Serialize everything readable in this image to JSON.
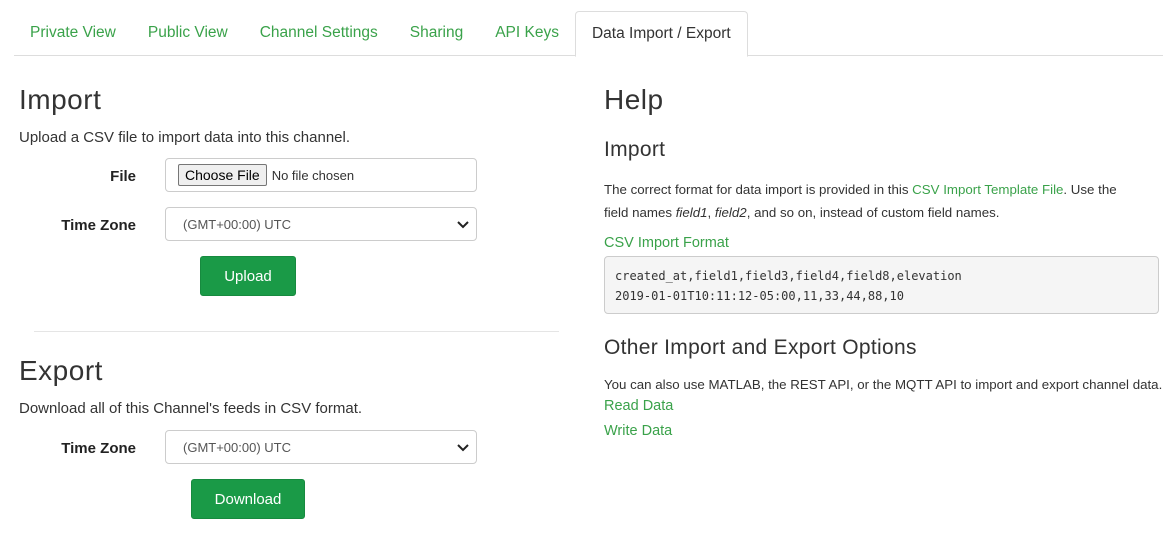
{
  "tabs": [
    {
      "label": "Private View",
      "active": false
    },
    {
      "label": "Public View",
      "active": false
    },
    {
      "label": "Channel Settings",
      "active": false
    },
    {
      "label": "Sharing",
      "active": false
    },
    {
      "label": "API Keys",
      "active": false
    },
    {
      "label": "Data Import / Export",
      "active": true
    }
  ],
  "import": {
    "title": "Import",
    "description": "Upload a CSV file to import data into this channel.",
    "file_label": "File",
    "choose_file": "Choose File",
    "no_file": "No file chosen",
    "timezone_label": "Time Zone",
    "timezone_value": "(GMT+00:00) UTC",
    "upload_label": "Upload"
  },
  "export": {
    "title": "Export",
    "description": "Download all of this Channel's feeds in CSV format.",
    "timezone_label": "Time Zone",
    "timezone_value": "(GMT+00:00) UTC",
    "download_label": "Download"
  },
  "help": {
    "title": "Help",
    "import_title": "Import",
    "import_text_1": "The correct format for data import is provided in this ",
    "template_link": "CSV Import Template File",
    "import_text_2": ". Use the",
    "import_text_3": "field names ",
    "field1": "field1",
    "comma": ", ",
    "field2": "field2",
    "import_text_4": ", and so on, instead of custom field names.",
    "format_link": "CSV Import Format",
    "code_line_1": "created_at,field1,field3,field4,field8,elevation",
    "code_line_2": "2019-01-01T10:11:12-05:00,11,33,44,88,10",
    "other_title": "Other Import and Export Options",
    "other_text": "You can also use MATLAB, the REST API, or the MQTT API to import and export channel data.",
    "read_link": "Read Data",
    "write_link": "Write Data"
  },
  "colors": {
    "accent_green": "#3aa24a",
    "button_green": "#1a9a47"
  },
  "icons": {
    "select_arrow": "chevron-down-icon"
  }
}
